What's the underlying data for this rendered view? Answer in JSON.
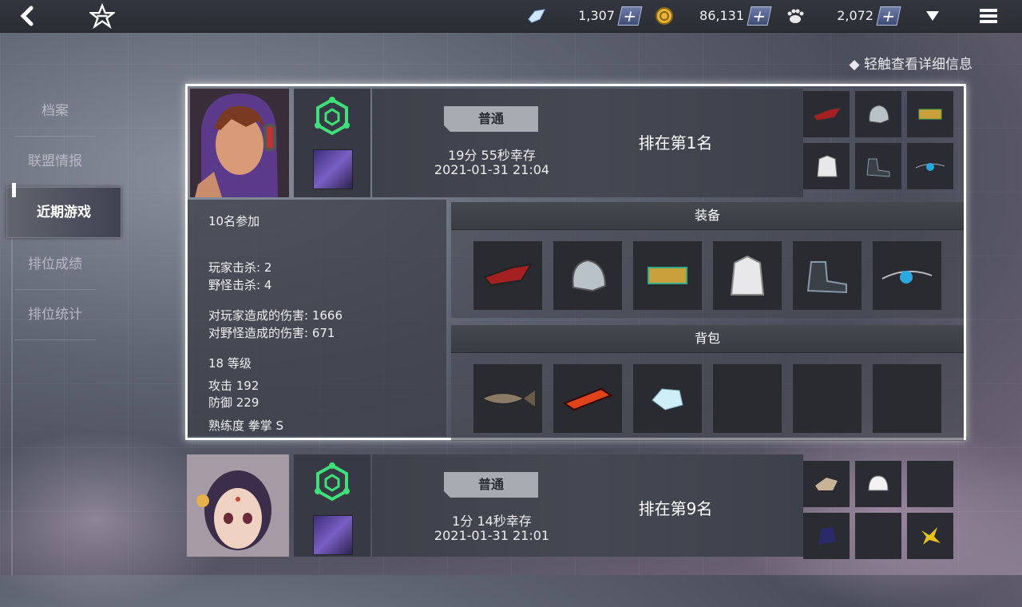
{
  "topbar": {
    "back_icon": "back-arrow-icon",
    "logo_icon": "star-logo-icon",
    "currencies": [
      {
        "icon": "crystal-icon",
        "value": "1,307"
      },
      {
        "icon": "gold-coin-icon",
        "value": "86,131"
      },
      {
        "icon": "paw-token-icon",
        "value": "2,072"
      }
    ],
    "plus_label": "+",
    "dropdown_icon": "triangle-down-icon",
    "menu_icon": "hamburger-menu-icon"
  },
  "hint": "◆ 轻触查看详细信息",
  "sidenav": {
    "items": [
      {
        "label": "档案"
      },
      {
        "label": "联盟情报"
      },
      {
        "label": "近期游戏"
      },
      {
        "label": "排位成绩"
      },
      {
        "label": "排位统计"
      }
    ],
    "active_index": 2
  },
  "games": [
    {
      "mode": "普通",
      "survival": "19分 55秒幸存",
      "datetime": "2021-01-31 21:04",
      "rank": "排在第1名",
      "participants": "10名参加",
      "player_kills": "玩家击杀: 2",
      "monster_kills": "野怪击杀: 4",
      "player_damage": "对玩家造成的伤害: 1666",
      "monster_damage": "对野怪造成的伤害: 671",
      "level": "18 等级",
      "attack": "攻击 192",
      "defense": "防御 229",
      "proficiency": "熟练度  拳掌 S",
      "equipment_title": "装备",
      "bag_title": "背包",
      "equipment": [
        "red-glove-icon",
        "silver-helmet-icon",
        "gold-bracer-icon",
        "white-cloth-armor-icon",
        "dark-boots-icon",
        "blue-pendant-icon"
      ],
      "bag": [
        "fish-icon",
        "red-bar-icon",
        "ice-crystal-icon",
        "",
        "",
        ""
      ]
    },
    {
      "mode": "普通",
      "survival": "1分 14秒幸存",
      "datetime": "2021-01-31 21:01",
      "rank": "排在第9名",
      "equipment": [
        "tan-glove-icon",
        "white-helmet-icon",
        "",
        "dark-blue-armor-icon",
        "",
        "gold-item-icon"
      ]
    }
  ],
  "colors": {
    "accent_green": "#3fe07a",
    "selected_border": "#ffffff"
  }
}
